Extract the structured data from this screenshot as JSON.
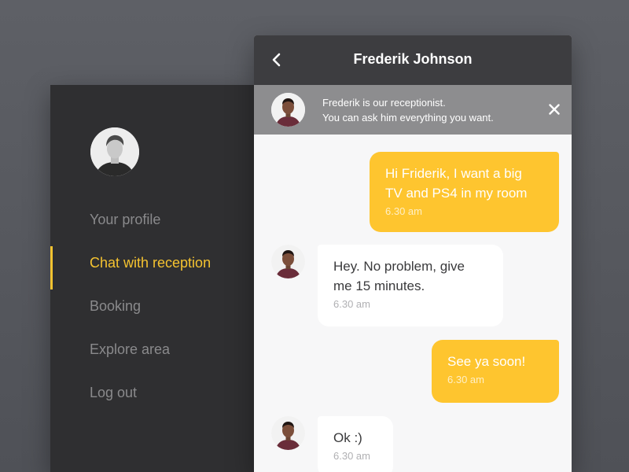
{
  "nav": {
    "avatar_icon": "user-avatar-icon",
    "items": [
      {
        "label": "Your profile",
        "active": false
      },
      {
        "label": "Chat with reception",
        "active": true
      },
      {
        "label": "Booking",
        "active": false
      },
      {
        "label": "Explore area",
        "active": false
      },
      {
        "label": "Log out",
        "active": false
      }
    ],
    "active_color": "#f5c330"
  },
  "chat": {
    "title": "Frederik Johnson",
    "back_icon": "chevron-left-icon",
    "banner": {
      "line1": "Frederik is our receptionist.",
      "line2": "You can ask him everything you want.",
      "close_icon": "close-icon"
    },
    "messages": [
      {
        "direction": "out",
        "text1": "Hi Friderik, I want a big",
        "text2": "TV and PS4 in my room",
        "time": "6.30 am"
      },
      {
        "direction": "in",
        "text1": "Hey. No problem, give",
        "text2": "me 15 minutes.",
        "time": "6.30 am"
      },
      {
        "direction": "out",
        "text1": "See ya soon!",
        "time": "6.30 am"
      },
      {
        "direction": "in",
        "text1": "Ok :)",
        "time": "6.30 am"
      }
    ],
    "colors": {
      "outgoing": "#fec52f",
      "incoming": "#ffffff",
      "header": "#3d3d40",
      "banner": "#8d8d8f"
    }
  }
}
